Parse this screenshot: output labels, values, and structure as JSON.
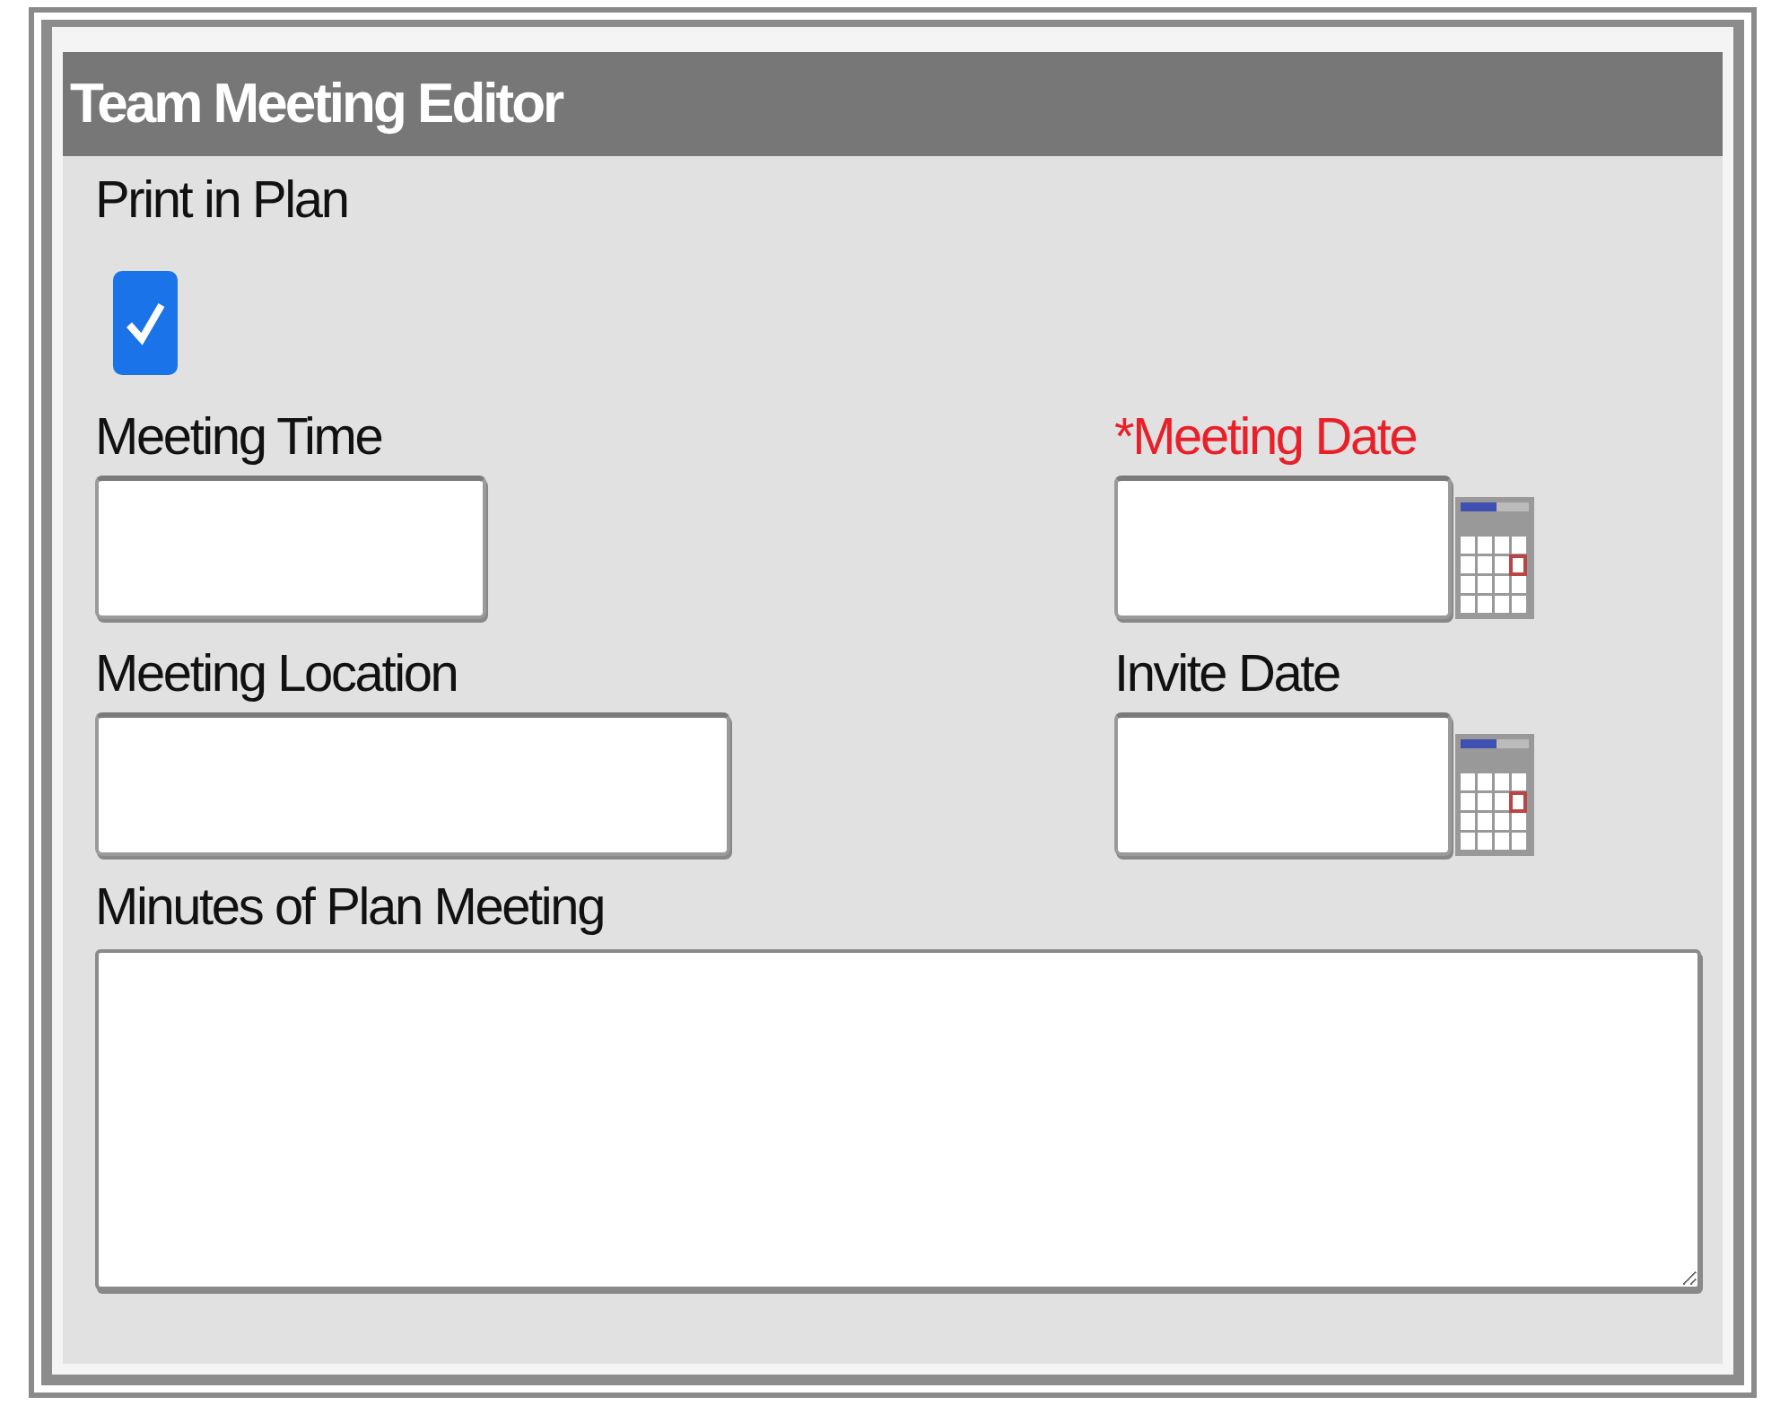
{
  "window": {
    "title": "Team Meeting Editor"
  },
  "print_in_plan": {
    "label": "Print in Plan",
    "checked": true
  },
  "fields": [
    {
      "label": "Meeting Time",
      "required": false,
      "kind": "text"
    },
    {
      "label": "*Meeting Date",
      "required": true,
      "kind": "date"
    },
    {
      "label": "Meeting Location",
      "required": false,
      "kind": "text"
    },
    {
      "label": "Invite Date",
      "required": false,
      "kind": "date"
    }
  ],
  "minutes": {
    "label": "Minutes of Plan Meeting"
  }
}
